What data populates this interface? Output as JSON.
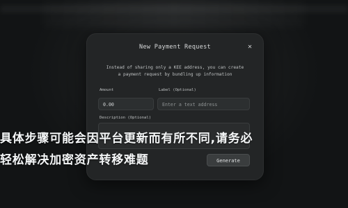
{
  "modal": {
    "title": "New Payment Request",
    "close_icon": "close-icon",
    "description_lines": [
      "Instead of sharing only a KEE address, you can create",
      "a payment request by bundling up information"
    ],
    "amount_label": "Amount",
    "amount_value": "0.00",
    "label_label": "Label (Optional)",
    "label_placeholder": "Enter a text address",
    "description_label": "Description (Optional)",
    "generate_label": "Generate"
  },
  "overlay": {
    "line1": "具体步骤可能会因平台更新而有所不同,请务必",
    "line2": "轻松解决加密资产转移难题"
  },
  "colors": {
    "background": "#121415",
    "modal": "#232526",
    "field": "#2c2f30",
    "text": "#d8dadb"
  }
}
